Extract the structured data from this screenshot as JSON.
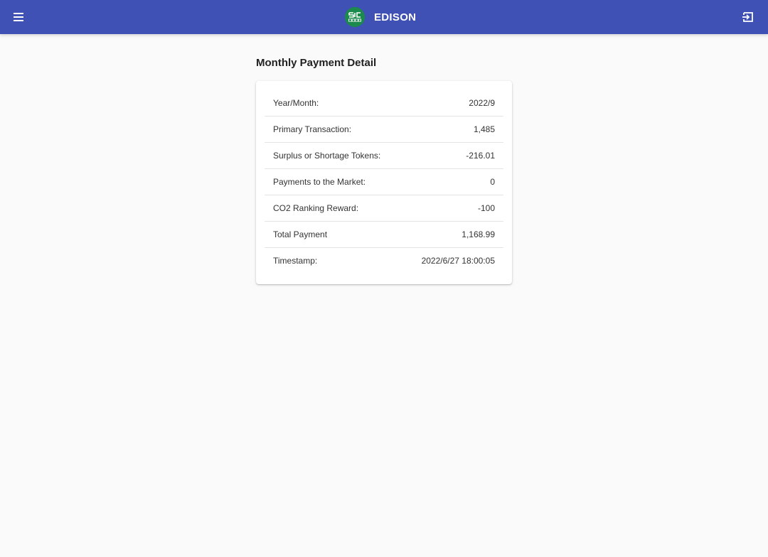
{
  "header": {
    "app_name": "EDISON",
    "logo_text": "SIC",
    "menu_icon": "menu-icon",
    "logout_icon": "logout-icon",
    "bar_color": "#3f51b5",
    "logo_color": "#1b8a4c"
  },
  "main": {
    "title": "Monthly Payment Detail",
    "rows": [
      {
        "label": "Year/Month:",
        "value": "2022/9"
      },
      {
        "label": "Primary Transaction:",
        "value": "1,485"
      },
      {
        "label": "Surplus or Shortage Tokens:",
        "value": "-216.01"
      },
      {
        "label": "Payments to the Market:",
        "value": "0"
      },
      {
        "label": "CO2 Ranking Reward:",
        "value": "-100"
      },
      {
        "label": "Total Payment",
        "value": "1,168.99"
      },
      {
        "label": "Timestamp:",
        "value": "2022/6/27 18:00:05"
      }
    ]
  }
}
